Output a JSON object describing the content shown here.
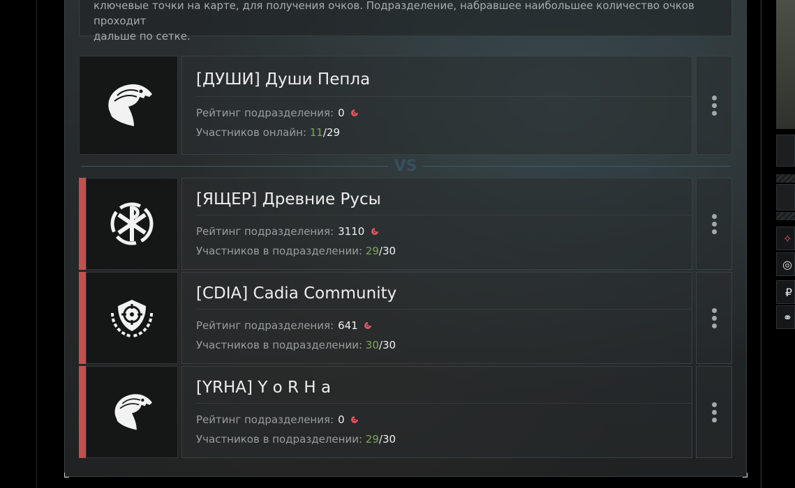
{
  "description": {
    "line1": "ключевые точки на карте, для получения очков. Подразделение, набравшее наибольшее количество очков проходит",
    "line2": "дальше по сетке."
  },
  "vs_label": "VS",
  "defender": {
    "name": "[ДУШИ] Души Пепла",
    "rating_label": "Рейтинг подразделения:",
    "rating": "0",
    "members_label": "Участников онлайн:",
    "members_current": "11",
    "members_total": "29",
    "emblem_icon": "eagle-head-icon"
  },
  "challengers": [
    {
      "name": "[ЯЩЕР] Древние Русы",
      "rating_label": "Рейтинг подразделения:",
      "rating": "3110",
      "members_label": "Участников в подразделении:",
      "members_current": "29",
      "members_total": "30",
      "emblem_icon": "chi-rho-kolovrat-icon"
    },
    {
      "name": "[CDIA] Cadia Community",
      "rating_label": "Рейтинг подразделения:",
      "rating": "641",
      "members_label": "Участников в подразделении:",
      "members_current": "30",
      "members_total": "30",
      "emblem_icon": "crosshair-shield-wreath-icon"
    },
    {
      "name": "[YRHA] Y o R H a",
      "rating_label": "Рейтинг подразделения:",
      "rating": "0",
      "members_label": "Участников в подразделении:",
      "members_current": "29",
      "members_total": "30",
      "emblem_icon": "eagle-head-icon"
    }
  ],
  "members_separator": "/",
  "sidebar_icons": [
    "brand-icon",
    "coin-icon",
    "ruble-icon",
    "link-icon"
  ],
  "colors": {
    "accent_red": "#c0514f",
    "online_green": "#7fa65c",
    "rating_icon": "#e0535e"
  }
}
